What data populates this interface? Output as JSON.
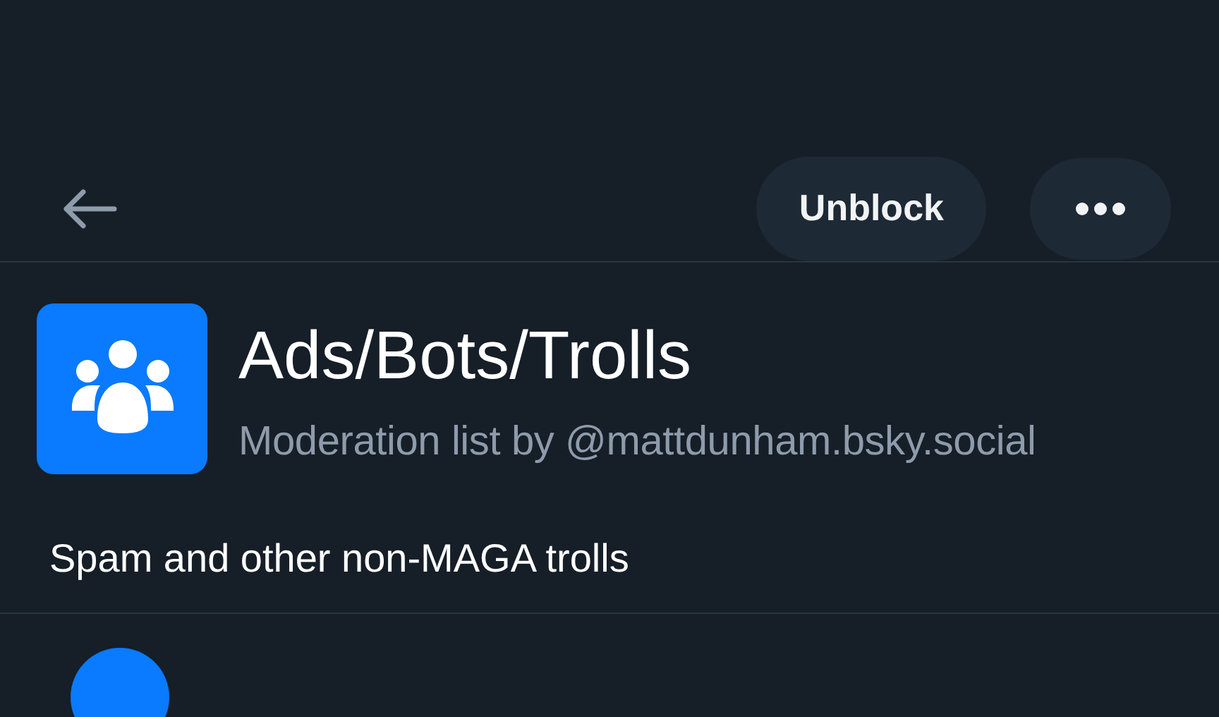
{
  "header": {
    "buttons": [
      {
        "kind": "text",
        "label": "Unblock"
      },
      {
        "kind": "more"
      }
    ]
  },
  "list": {
    "title": "Ads/Bots/Trolls",
    "subtitle": "Moderation list by @mattdunham.bsky.social",
    "description": "Spam and other non-MAGA trolls"
  }
}
